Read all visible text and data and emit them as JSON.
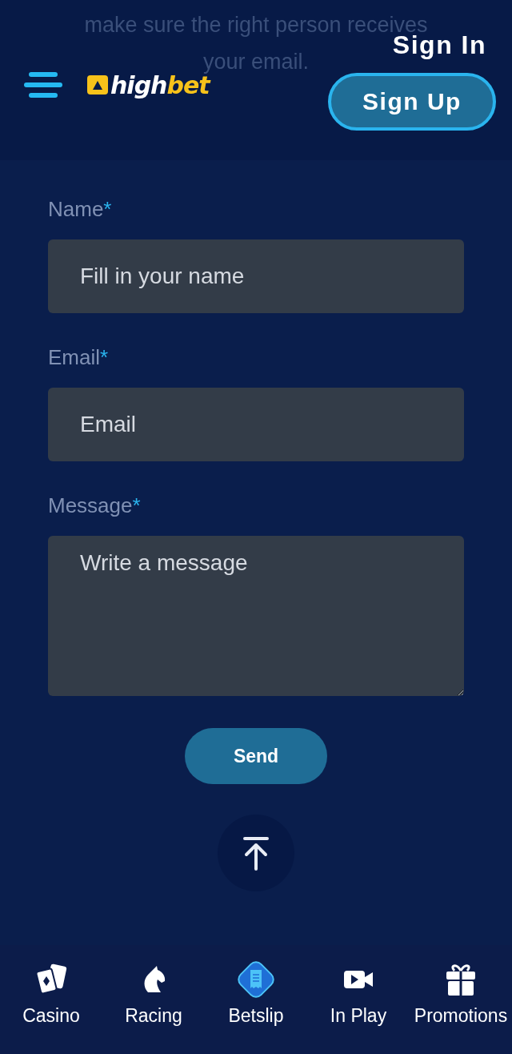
{
  "intro_lines": [
    "make sure the right person receives",
    "your email."
  ],
  "header": {
    "logo": {
      "part_1": "high",
      "part_2": "bet"
    },
    "sign_in": "Sign In",
    "sign_up": "Sign Up"
  },
  "form": {
    "fields": [
      {
        "kind": "input",
        "label": "Name",
        "required_mark": "*",
        "placeholder": "Fill in your name"
      },
      {
        "kind": "input",
        "label": "Email",
        "required_mark": "*",
        "placeholder": "Email"
      },
      {
        "kind": "textarea",
        "label": "Message",
        "required_mark": "*",
        "placeholder": "Write a message"
      }
    ],
    "submit": "Send"
  },
  "bottom_nav": [
    {
      "kind": "cards",
      "label": "Casino"
    },
    {
      "kind": "horse",
      "label": "Racing"
    },
    {
      "kind": "receipt",
      "label": "Betslip"
    },
    {
      "kind": "video",
      "label": "In Play"
    },
    {
      "kind": "gift",
      "label": "Promotions"
    }
  ]
}
